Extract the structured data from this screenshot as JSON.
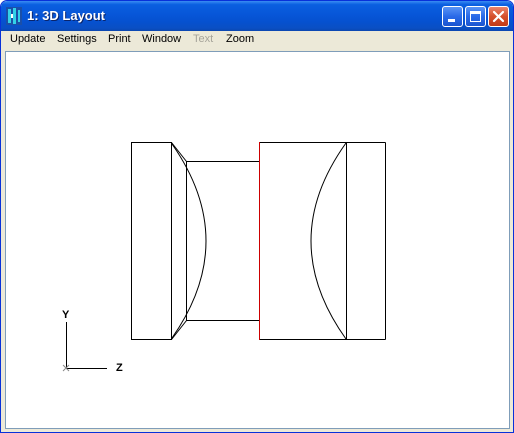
{
  "window": {
    "title": "1: 3D Layout"
  },
  "menu": {
    "items": [
      {
        "label": "Update",
        "enabled": true
      },
      {
        "label": "Settings",
        "enabled": true
      },
      {
        "label": "Print",
        "enabled": true
      },
      {
        "label": "Window",
        "enabled": true
      },
      {
        "label": "Text",
        "enabled": false
      },
      {
        "label": "Zoom",
        "enabled": true
      }
    ]
  },
  "axes": {
    "y_label": "Y",
    "z_label": "Z"
  },
  "colors": {
    "titlebar": "#0756d8",
    "close_button": "#c23a17",
    "stop_surface": "#cc0000",
    "outline": "#000000"
  },
  "icons": {
    "app": "lens-app-icon",
    "minimize": "minimize-icon",
    "maximize": "maximize-icon",
    "close": "close-icon"
  }
}
